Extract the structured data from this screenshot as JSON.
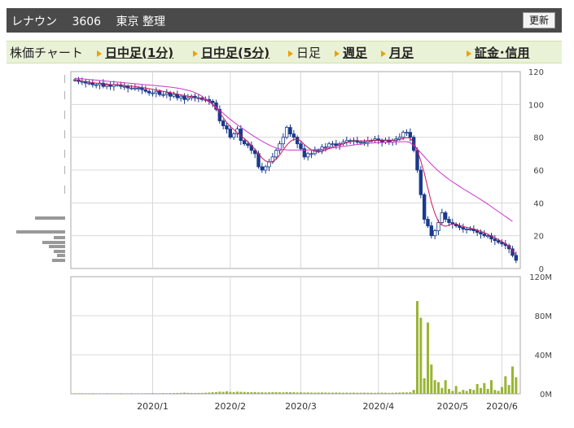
{
  "header": {
    "company": "レナウン",
    "code": "3606",
    "market": "東京 整理",
    "update_label": "更新"
  },
  "nav": {
    "title": "株価チャート",
    "intraday_1m": "日中足(1分)",
    "intraday_5m": "日中足(5分)",
    "daily": "日足",
    "weekly": "週足",
    "monthly": "月足",
    "margin": "証金･信用"
  },
  "colors": {
    "candle_up": "#ffffff",
    "candle_down": "#1a3a8c",
    "ma_short": "#d0145a",
    "ma_long": "#cc33cc",
    "volume": "#99b533",
    "volume_profile": "#999999"
  },
  "chart_data": [
    {
      "type": "candlestick",
      "title": "",
      "x_labels": [
        "2020/1",
        "2020/2",
        "2020/3",
        "2020/4",
        "2020/5",
        "2020/6"
      ],
      "y_ticks": [
        "0",
        "20",
        "40",
        "60",
        "80",
        "100",
        "120"
      ],
      "ylim": [
        0,
        120
      ],
      "grid": true,
      "close": [
        115,
        114,
        114,
        113,
        113,
        112,
        112,
        113,
        111,
        112,
        111,
        112,
        112,
        111,
        111,
        110,
        110,
        110,
        110,
        109,
        108,
        107,
        107,
        108,
        106,
        106,
        107,
        105,
        106,
        104,
        105,
        103,
        104,
        105,
        104,
        104,
        103,
        103,
        102,
        101,
        97,
        90,
        87,
        85,
        80,
        82,
        85,
        78,
        76,
        75,
        72,
        70,
        62,
        60,
        62,
        65,
        68,
        72,
        76,
        80,
        86,
        82,
        80,
        76,
        73,
        68,
        70,
        70,
        72,
        72,
        74,
        74,
        76,
        76,
        75,
        76,
        77,
        78,
        78,
        78,
        77,
        77,
        77,
        78,
        78,
        79,
        78,
        77,
        78,
        77,
        78,
        79,
        80,
        83,
        83,
        80,
        72,
        60,
        45,
        30,
        26,
        20,
        23,
        28,
        34,
        30,
        28,
        27,
        26,
        25,
        24,
        24,
        24,
        23,
        22,
        21,
        20,
        20,
        18,
        17,
        16,
        15,
        14,
        12,
        8,
        5
      ],
      "ma_short": [
        115,
        114.6,
        114.2,
        113.9,
        113.6,
        113.3,
        113.0,
        112.8,
        112.5,
        112.3,
        112.1,
        112.0,
        111.9,
        111.7,
        111.5,
        111.3,
        111.1,
        110.9,
        110.6,
        110.3,
        110.0,
        109.6,
        109.2,
        108.8,
        108.4,
        108.0,
        107.6,
        107.2,
        106.8,
        106.3,
        105.8,
        105.4,
        105.0,
        104.7,
        104.4,
        104.1,
        103.6,
        102.8,
        101.6,
        100.0,
        97.7,
        94.8,
        92.0,
        89.0,
        86.6,
        84.6,
        82.7,
        80.9,
        79.2,
        77.3,
        75.0,
        72.7,
        69.8,
        67.4,
        65.5,
        64.9,
        65.2,
        66.6,
        69.1,
        72.2,
        75.2,
        77.4,
        78.7,
        78.9,
        77.8,
        75.5,
        73.8,
        72.3,
        71.4,
        70.9,
        71.3,
        72.1,
        73.1,
        74.0,
        74.8,
        75.4,
        76.1,
        76.7,
        77.2,
        77.6,
        77.7,
        77.8,
        77.8,
        77.9,
        78.0,
        78.2,
        78.3,
        78.3,
        78.3,
        78.2,
        78.2,
        78.3,
        78.6,
        79.2,
        79.8,
        79.4,
        76.8,
        72.0,
        65.6,
        58.0,
        49.0,
        40.3,
        33.4,
        28.6,
        26.4,
        25.8,
        26.4,
        27.2,
        27.2,
        26.3,
        25.6,
        25.1,
        24.6,
        24.1,
        23.4,
        22.6,
        21.8,
        20.9,
        19.8,
        18.7,
        17.6,
        16.4,
        15.1,
        13.4,
        11.0,
        8.3
      ],
      "ma_long": [
        116,
        115.8,
        115.6,
        115.4,
        115.2,
        115.0,
        114.8,
        114.6,
        114.4,
        114.2,
        114.0,
        113.8,
        113.6,
        113.4,
        113.2,
        113.0,
        112.8,
        112.6,
        112.4,
        112.2,
        112.0,
        111.8,
        111.6,
        111.4,
        111.2,
        111.0,
        110.8,
        110.6,
        110.3,
        110.0,
        109.6,
        109.1,
        108.6,
        108.0,
        107.2,
        106.2,
        105.0,
        103.6,
        102.0,
        100.2,
        98.4,
        96.5,
        94.6,
        92.7,
        90.9,
        89.2,
        87.6,
        86.0,
        84.5,
        83.0,
        81.6,
        80.2,
        78.9,
        77.6,
        76.4,
        75.3,
        74.3,
        73.5,
        72.9,
        72.5,
        72.3,
        72.2,
        72.2,
        72.2,
        72.2,
        72.2,
        72.2,
        72.3,
        72.4,
        72.5,
        72.7,
        72.9,
        73.2,
        73.5,
        73.8,
        74.1,
        74.4,
        74.7,
        75.0,
        75.3,
        75.6,
        75.8,
        76.0,
        76.2,
        76.4,
        76.6,
        76.7,
        76.8,
        76.9,
        77.0,
        77.0,
        77.1,
        77.2,
        77.3,
        77.3,
        76.6,
        74.9,
        72.9,
        70.6,
        68.2,
        65.8,
        63.5,
        61.4,
        59.4,
        57.6,
        55.9,
        54.3,
        52.8,
        51.4,
        50.0,
        48.6,
        47.3,
        46.0,
        44.7,
        43.4,
        42.0,
        40.6,
        39.2,
        37.7,
        36.2,
        34.7,
        33.2,
        31.7,
        30.2,
        28.7
      ]
    },
    {
      "type": "bar",
      "title": "",
      "y_ticks": [
        "0M",
        "40M",
        "80M",
        "120M"
      ],
      "ylim": [
        0,
        120
      ],
      "unit": "M",
      "values": [
        0.5,
        0.5,
        0.6,
        0.5,
        0.5,
        0.6,
        0.5,
        0.5,
        0.5,
        0.6,
        0.5,
        0.5,
        0.5,
        0.6,
        0.5,
        0.5,
        0.6,
        0.5,
        0.5,
        0.5,
        0.6,
        0.6,
        0.7,
        0.6,
        0.6,
        0.7,
        0.6,
        0.7,
        0.8,
        0.9,
        1.0,
        1.2,
        1.0,
        0.9,
        0.8,
        0.9,
        1.0,
        1.1,
        1.3,
        1.6,
        1.8,
        2.2,
        2.0,
        2.5,
        2.0,
        1.8,
        2.2,
        2.0,
        1.9,
        1.7,
        1.6,
        1.8,
        1.5,
        1.6,
        1.4,
        1.5,
        1.8,
        1.7,
        1.6,
        1.5,
        1.8,
        1.7,
        1.6,
        1.4,
        1.5,
        1.3,
        1.4,
        1.3,
        1.2,
        1.3,
        1.4,
        1.3,
        1.2,
        1.2,
        1.3,
        1.2,
        1.1,
        1.2,
        1.1,
        1.2,
        1.1,
        1.1,
        1.2,
        1.1,
        1.1,
        1.0,
        1.1,
        1.2,
        1.1,
        1.0,
        1.1,
        1.2,
        1.3,
        1.5,
        1.4,
        1.6,
        4.0,
        95,
        78,
        16,
        73,
        30,
        14,
        12,
        6,
        14,
        5,
        3,
        8,
        2,
        4,
        3,
        5,
        4,
        10,
        6,
        11,
        5,
        14,
        4,
        3,
        7,
        18,
        9,
        28,
        17
      ]
    }
  ]
}
